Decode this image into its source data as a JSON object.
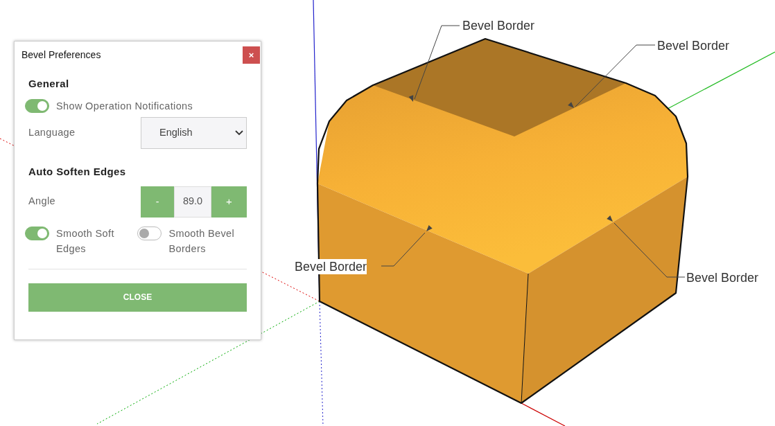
{
  "dialog": {
    "title": "Bevel Preferences",
    "close_icon": "×",
    "general": {
      "heading": "General",
      "toggle": {
        "label": "Show Operation Notifications",
        "on": true
      },
      "language": {
        "label": "Language",
        "value": "English"
      }
    },
    "auto_soften": {
      "heading": "Auto Soften Edges",
      "angle": {
        "label": "Angle",
        "minus": "-",
        "value": "89.0",
        "plus": "+"
      },
      "toggles": [
        {
          "label": "Smooth Soft Edges",
          "on": true
        },
        {
          "label": "Smooth Bevel Borders",
          "on": false
        }
      ]
    },
    "close_button": "CLOSE"
  },
  "annotations": [
    {
      "text": "Bevel Border"
    },
    {
      "text": "Bevel Border"
    },
    {
      "text": "Bevel Border"
    },
    {
      "text": "Bevel Border"
    }
  ]
}
